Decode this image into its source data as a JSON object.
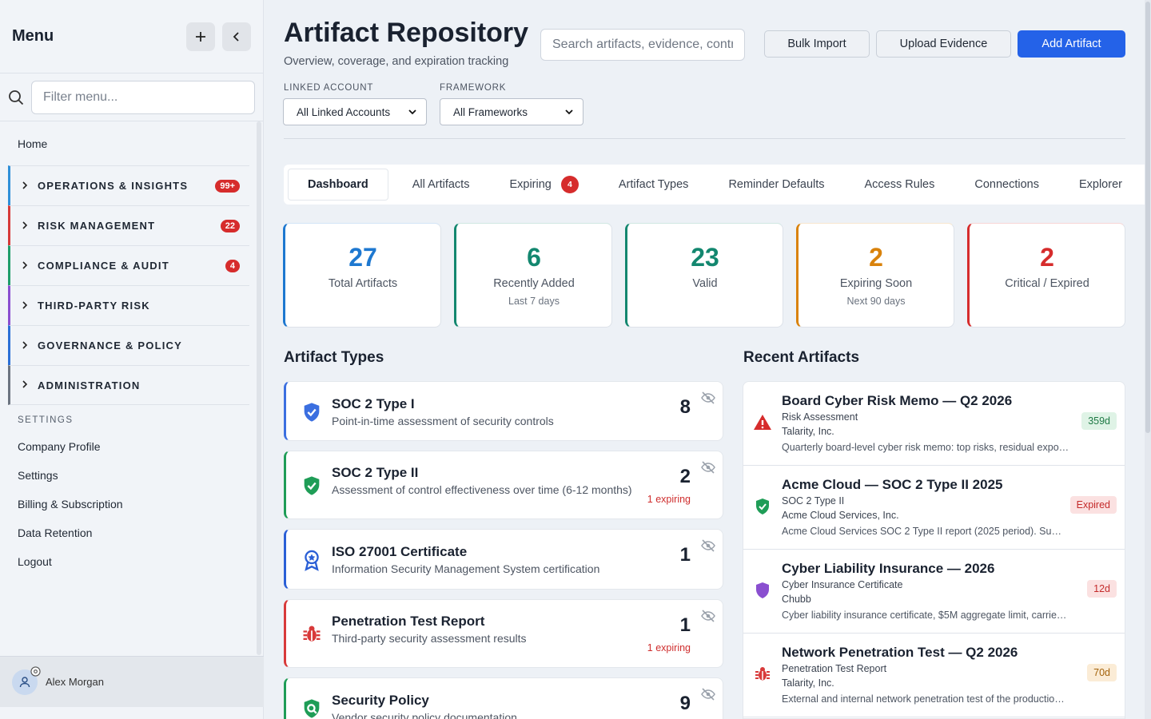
{
  "colors": {
    "primary": "#2462e8",
    "danger": "#d62c2c",
    "teal": "#13876f",
    "green": "#1f9d57",
    "orange": "#d9820b",
    "blue": "#1e78d0"
  },
  "sidebar": {
    "title": "Menu",
    "add_icon": "plus-icon",
    "collapse_icon": "chevron-left-icon",
    "filter_placeholder": "Filter menu...",
    "home": "Home",
    "groups": [
      {
        "label": "OPERATIONS & INSIGHTS",
        "badge": "99+",
        "color": "#2f8fd8"
      },
      {
        "label": "RISK MANAGEMENT",
        "badge": "22",
        "color": "#d63a3a"
      },
      {
        "label": "COMPLIANCE & AUDIT",
        "badge": "4",
        "color": "#1f9d6a"
      },
      {
        "label": "THIRD-PARTY RISK",
        "badge": "",
        "color": "#8a4fd0"
      },
      {
        "label": "GOVERNANCE & POLICY",
        "badge": "",
        "color": "#2a6fd6"
      },
      {
        "label": "ADMINISTRATION",
        "badge": "",
        "color": "#6c7480"
      }
    ],
    "settings_title": "SETTINGS",
    "settings": [
      "Company Profile",
      "Settings",
      "Billing & Subscription",
      "Data Retention",
      "Logout"
    ],
    "user": "Alex Morgan"
  },
  "header": {
    "title": "Artifact Repository",
    "subtitle": "Overview, coverage, and expiration tracking",
    "search_placeholder": "Search artifacts, evidence, controls...",
    "bulk_import": "Bulk Import",
    "upload_evidence": "Upload Evidence",
    "add_artifact": "Add Artifact"
  },
  "filters": {
    "linked_label": "LINKED ACCOUNT",
    "linked_value": "All Linked Accounts",
    "framework_label": "FRAMEWORK",
    "framework_value": "All Frameworks"
  },
  "tabs": [
    {
      "label": "Dashboard",
      "badge": ""
    },
    {
      "label": "All Artifacts",
      "badge": ""
    },
    {
      "label": "Expiring",
      "badge": "4"
    },
    {
      "label": "Artifact Types",
      "badge": ""
    },
    {
      "label": "Reminder Defaults",
      "badge": ""
    },
    {
      "label": "Access Rules",
      "badge": ""
    },
    {
      "label": "Connections",
      "badge": ""
    },
    {
      "label": "Explorer",
      "badge": ""
    }
  ],
  "stats": [
    {
      "value": "27",
      "label": "Total Artifacts",
      "sub": "",
      "color": "#1e78d0"
    },
    {
      "value": "6",
      "label": "Recently Added",
      "sub": "Last 7 days",
      "color": "#13876f"
    },
    {
      "value": "23",
      "label": "Valid",
      "sub": "",
      "color": "#13876f"
    },
    {
      "value": "2",
      "label": "Expiring Soon",
      "sub": "Next 90 days",
      "color": "#d9820b"
    },
    {
      "value": "2",
      "label": "Critical / Expired",
      "sub": "",
      "color": "#d62c2c"
    }
  ],
  "artifact_types": {
    "title": "Artifact Types",
    "items": [
      {
        "name": "SOC 2 Type I",
        "desc": "Point-in-time assessment of security controls",
        "count": "8",
        "expiring": "",
        "icon": "shield-check-icon",
        "color": "#3b6fe0"
      },
      {
        "name": "SOC 2 Type II",
        "desc": "Assessment of control effectiveness over time (6-12 months)",
        "count": "2",
        "expiring": "1 expiring",
        "icon": "shield-check-icon",
        "color": "#1f9d57"
      },
      {
        "name": "ISO 27001 Certificate",
        "desc": "Information Security Management System certification",
        "count": "1",
        "expiring": "",
        "icon": "award-icon",
        "color": "#2a5fd6"
      },
      {
        "name": "Penetration Test Report",
        "desc": "Third-party security assessment results",
        "count": "1",
        "expiring": "1 expiring",
        "icon": "bug-icon",
        "color": "#d83a3a"
      },
      {
        "name": "Security Policy",
        "desc": "Vendor security policy documentation",
        "count": "9",
        "expiring": "",
        "icon": "shield-search-icon",
        "color": "#1f9d57"
      }
    ]
  },
  "recent": {
    "title": "Recent Artifacts",
    "items": [
      {
        "title": "Board Cyber Risk Memo — Q2 2026",
        "type": "Risk Assessment",
        "org": "Talarity, Inc.",
        "desc": "Quarterly board-level cyber risk memo: top risks, residual exposure and planned mitigations",
        "badge": "359d",
        "badge_kind": "ok",
        "icon": "warning-icon"
      },
      {
        "title": "Acme Cloud — SOC 2 Type II 2025",
        "type": "SOC 2 Type II",
        "org": "Acme Cloud Services, Inc.",
        "desc": "Acme Cloud Services SOC 2 Type II report (2025 period). Summary of controls tested",
        "badge": "Expired",
        "badge_kind": "bad",
        "icon": "shield-check-icon"
      },
      {
        "title": "Cyber Liability Insurance — 2026",
        "type": "Cyber Insurance Certificate",
        "org": "Chubb",
        "desc": "Cyber liability insurance certificate, $5M aggregate limit, carrier details included",
        "badge": "12d",
        "badge_kind": "bad",
        "icon": "shield-icon"
      },
      {
        "title": "Network Penetration Test — Q2 2026",
        "type": "Penetration Test Report",
        "org": "Talarity, Inc.",
        "desc": "External and internal network penetration test of the production environment",
        "badge": "70d",
        "badge_kind": "warn",
        "icon": "bug-icon"
      }
    ]
  }
}
